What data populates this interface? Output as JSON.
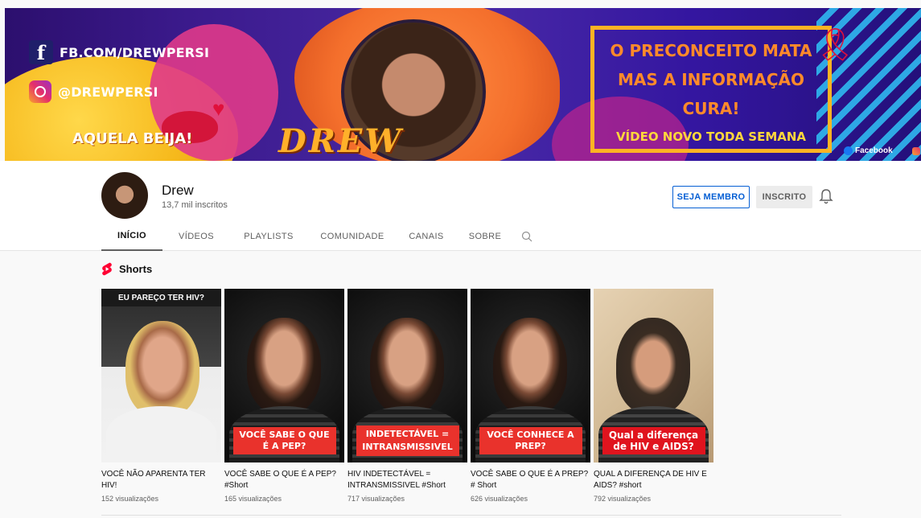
{
  "banner": {
    "facebook_handle": "FB.COM/DREWPERSI",
    "instagram_handle": "@DREWPERSI",
    "tagline": "AQUELA BEIJA!",
    "logo_text": "DREW",
    "promo_line1": "O PRECONCEITO MATA",
    "promo_line2": "MAS A INFORMAÇÃO CURA!",
    "promo_line3": "VÍDEO NOVO TODA SEMANA",
    "facebook_link_label": "Facebook"
  },
  "channel": {
    "name": "Drew",
    "subscribers": "13,7 mil inscritos",
    "member_button": "SEJA MEMBRO",
    "subscribed_button": "INSCRITO"
  },
  "tabs": [
    {
      "label": "INÍCIO",
      "active": true
    },
    {
      "label": "VÍDEOS",
      "active": false
    },
    {
      "label": "PLAYLISTS",
      "active": false
    },
    {
      "label": "COMUNIDADE",
      "active": false
    },
    {
      "label": "CANAIS",
      "active": false
    },
    {
      "label": "SOBRE",
      "active": false
    }
  ],
  "shorts": {
    "heading": "Shorts",
    "items": [
      {
        "title": "VOCÊ NÃO APARENTA TER HIV!",
        "views": "152 visualizações",
        "top_caption": "EU PAREÇO TER HIV?",
        "caption": ""
      },
      {
        "title": "VOCÊ SABE O QUE É A PEP? #Short",
        "views": "165 visualizações",
        "top_caption": "",
        "caption": "VOCÊ SABE O QUE É A PEP?"
      },
      {
        "title": "HIV INDETECTÁVEL = INTRANSMISSIVEL #Short",
        "views": "717 visualizações",
        "top_caption": "",
        "caption": "INDETECTÁVEL = INTRANSMISSIVEL"
      },
      {
        "title": "VOCÊ SABE O QUE É A PREP? # Short",
        "views": "626 visualizações",
        "top_caption": "",
        "caption": "VOCÊ CONHECE A PREP?"
      },
      {
        "title": "QUAL A DIFERENÇA DE HIV E AIDS? #short",
        "views": "792 visualizações",
        "top_caption": "",
        "caption": "Qual a diferença de HIV e AIDS?"
      }
    ]
  },
  "colors": {
    "link_blue": "#065fd4",
    "shorts_red": "#ff0033",
    "caption_red": "#e9322c"
  }
}
